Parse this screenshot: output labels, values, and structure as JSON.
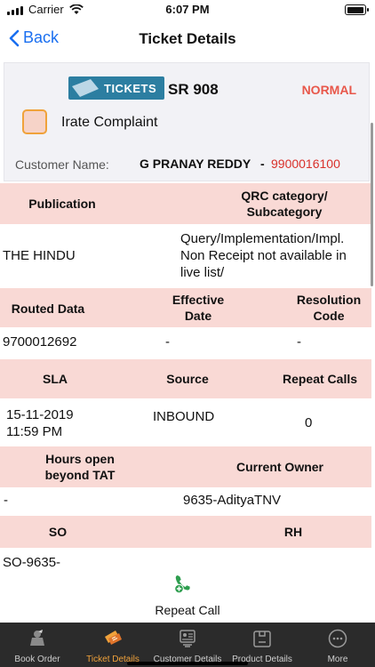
{
  "status_bar": {
    "carrier": "Carrier",
    "time": "6:07 PM"
  },
  "nav": {
    "back_label": "Back",
    "title": "Ticket Details"
  },
  "ticket": {
    "logo_text": "TICKETS",
    "sr_number": "SR 908",
    "priority": "NORMAL",
    "priority_color": "#e8574a",
    "irate_label": "Irate Complaint",
    "irate_checked": false,
    "customer_label": "Customer Name:",
    "customer_name": "G PRANAY REDDY",
    "separator": "-",
    "customer_phone": "9900016100"
  },
  "details": {
    "publication_header": "Publication",
    "qrc_header_line1": "QRC category/",
    "qrc_header_line2": "Subcategory",
    "publication_value": "THE HINDU",
    "qrc_value_line1": "Query/Implementation/Impl.",
    "qrc_value_line2": "Non Receipt not available in",
    "qrc_value_line3": "live list/",
    "routed_header": "Routed Data",
    "effective_header_line1": "Effective",
    "effective_header_line2": "Date",
    "resolution_header_line1": "Resolution",
    "resolution_header_line2": "Code",
    "routed_value": "9700012692",
    "effective_value": "-",
    "resolution_value": "-",
    "sla_header": "SLA",
    "source_header": "Source",
    "repeat_header": "Repeat Calls",
    "sla_value_line1": "15-11-2019",
    "sla_value_line2": "11:59 PM",
    "source_value": "INBOUND",
    "repeat_value": "0",
    "hours_header_line1": "Hours open",
    "hours_header_line2": "beyond TAT",
    "owner_header": "Current Owner",
    "hours_value": "-",
    "owner_value": "9635-AdityaTNV",
    "so_header": "SO",
    "rh_header": "RH",
    "so_value": "SO-9635-"
  },
  "repeat_call": {
    "label": "Repeat Call",
    "icon": "phone-plus-icon"
  },
  "tabs": [
    {
      "label": "Book Order",
      "icon": "book-order-icon",
      "active": false
    },
    {
      "label": "Ticket Details",
      "icon": "tickets-icon",
      "active": true
    },
    {
      "label": "Customer Details",
      "icon": "customer-details-icon",
      "active": false
    },
    {
      "label": "Product Details",
      "icon": "product-details-icon",
      "active": false
    },
    {
      "label": "More",
      "icon": "more-icon",
      "active": false
    }
  ],
  "colors": {
    "accent": "#1a6ff0",
    "header_bg": "#f9d9d5",
    "tab_bar": "#2b2b2b",
    "active_tab": "#f0a23b",
    "phone": "#d9312b"
  }
}
